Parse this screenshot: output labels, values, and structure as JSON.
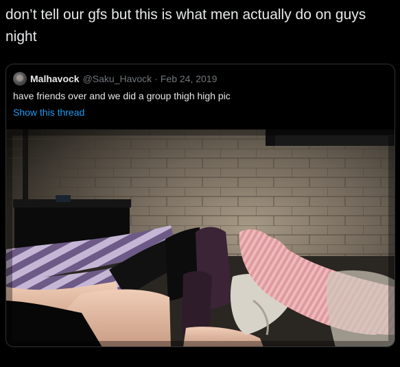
{
  "tweet": {
    "text": "don’t tell our gfs but this is what men actually do on guys night"
  },
  "quote": {
    "display_name": "Malhavock",
    "handle": "@Saku_Havock",
    "separator": "·",
    "date": "Feb 24, 2019",
    "text": "have friends over and we did a group thigh high pic",
    "show_thread_label": "Show this thread",
    "link_color": "#1d9bf0",
    "avatar_icon": "avatar-icon"
  }
}
